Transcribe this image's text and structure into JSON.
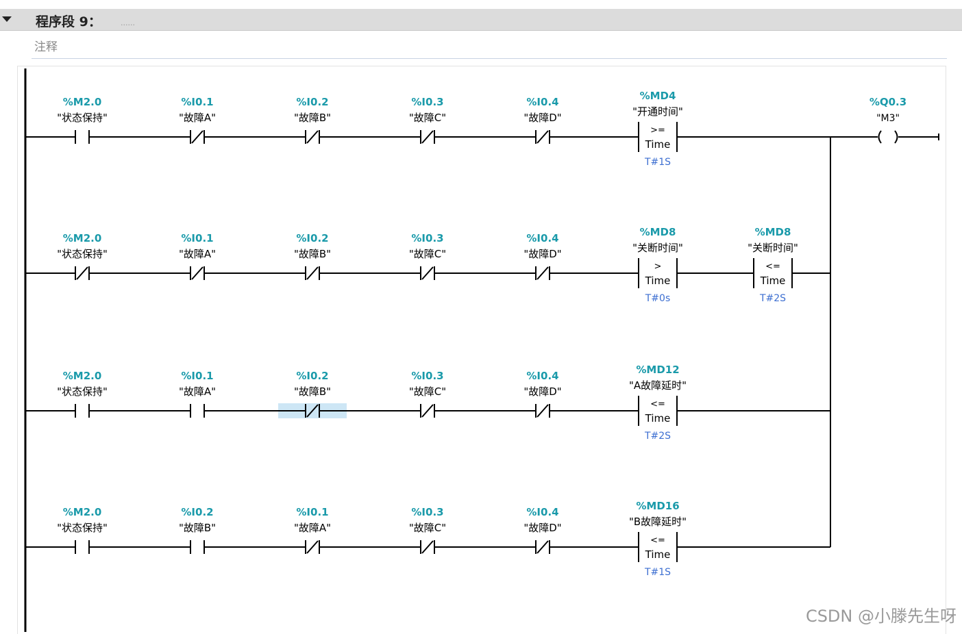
{
  "network": {
    "title": "程序段 9：",
    "title_placeholder": "......",
    "comment": "注释"
  },
  "colors": {
    "address": "#1a9aaa",
    "preset": "#3d6fd1",
    "wire": "#000000",
    "selection": "#cde6f5"
  },
  "rungs": [
    {
      "elements": [
        {
          "kind": "contact",
          "type": "NO",
          "address": "%M2.0",
          "tag": "\"状态保持\""
        },
        {
          "kind": "contact",
          "type": "NC",
          "address": "%I0.1",
          "tag": "\"故障A\""
        },
        {
          "kind": "contact",
          "type": "NC",
          "address": "%I0.2",
          "tag": "\"故障B\""
        },
        {
          "kind": "contact",
          "type": "NC",
          "address": "%I0.3",
          "tag": "\"故障C\""
        },
        {
          "kind": "contact",
          "type": "NC",
          "address": "%I0.4",
          "tag": "\"故障D\""
        },
        {
          "kind": "compare",
          "address": "%MD4",
          "tag": "\"开通时间\"",
          "op": ">=",
          "dtype": "Time",
          "preset": "T#1S"
        }
      ],
      "coil": {
        "address": "%Q0.3",
        "tag": "\"M3\""
      }
    },
    {
      "elements": [
        {
          "kind": "contact",
          "type": "NC",
          "address": "%M2.0",
          "tag": "\"状态保持\""
        },
        {
          "kind": "contact",
          "type": "NC",
          "address": "%I0.1",
          "tag": "\"故障A\""
        },
        {
          "kind": "contact",
          "type": "NC",
          "address": "%I0.2",
          "tag": "\"故障B\""
        },
        {
          "kind": "contact",
          "type": "NC",
          "address": "%I0.3",
          "tag": "\"故障C\""
        },
        {
          "kind": "contact",
          "type": "NC",
          "address": "%I0.4",
          "tag": "\"故障D\""
        },
        {
          "kind": "compare",
          "address": "%MD8",
          "tag": "\"关断时间\"",
          "op": ">",
          "dtype": "Time",
          "preset": "T#0s"
        },
        {
          "kind": "compare",
          "address": "%MD8",
          "tag": "\"关断时间\"",
          "op": "<=",
          "dtype": "Time",
          "preset": "T#2S"
        }
      ]
    },
    {
      "elements": [
        {
          "kind": "contact",
          "type": "NO",
          "address": "%M2.0",
          "tag": "\"状态保持\""
        },
        {
          "kind": "contact",
          "type": "NO",
          "address": "%I0.1",
          "tag": "\"故障A\""
        },
        {
          "kind": "contact",
          "type": "NC",
          "address": "%I0.2",
          "tag": "\"故障B\"",
          "selected": true
        },
        {
          "kind": "contact",
          "type": "NC",
          "address": "%I0.3",
          "tag": "\"故障C\""
        },
        {
          "kind": "contact",
          "type": "NC",
          "address": "%I0.4",
          "tag": "\"故障D\""
        },
        {
          "kind": "compare",
          "address": "%MD12",
          "tag": "\"A故障延时\"",
          "op": "<=",
          "dtype": "Time",
          "preset": "T#2S"
        }
      ]
    },
    {
      "elements": [
        {
          "kind": "contact",
          "type": "NO",
          "address": "%M2.0",
          "tag": "\"状态保持\""
        },
        {
          "kind": "contact",
          "type": "NO",
          "address": "%I0.2",
          "tag": "\"故障B\""
        },
        {
          "kind": "contact",
          "type": "NC",
          "address": "%I0.1",
          "tag": "\"故障A\""
        },
        {
          "kind": "contact",
          "type": "NC",
          "address": "%I0.3",
          "tag": "\"故障C\""
        },
        {
          "kind": "contact",
          "type": "NC",
          "address": "%I0.4",
          "tag": "\"故障D\""
        },
        {
          "kind": "compare",
          "address": "%MD16",
          "tag": "\"B故障延时\"",
          "op": "<=",
          "dtype": "Time",
          "preset": "T#1S"
        }
      ]
    }
  ],
  "watermark": "CSDN @小滕先生呀"
}
